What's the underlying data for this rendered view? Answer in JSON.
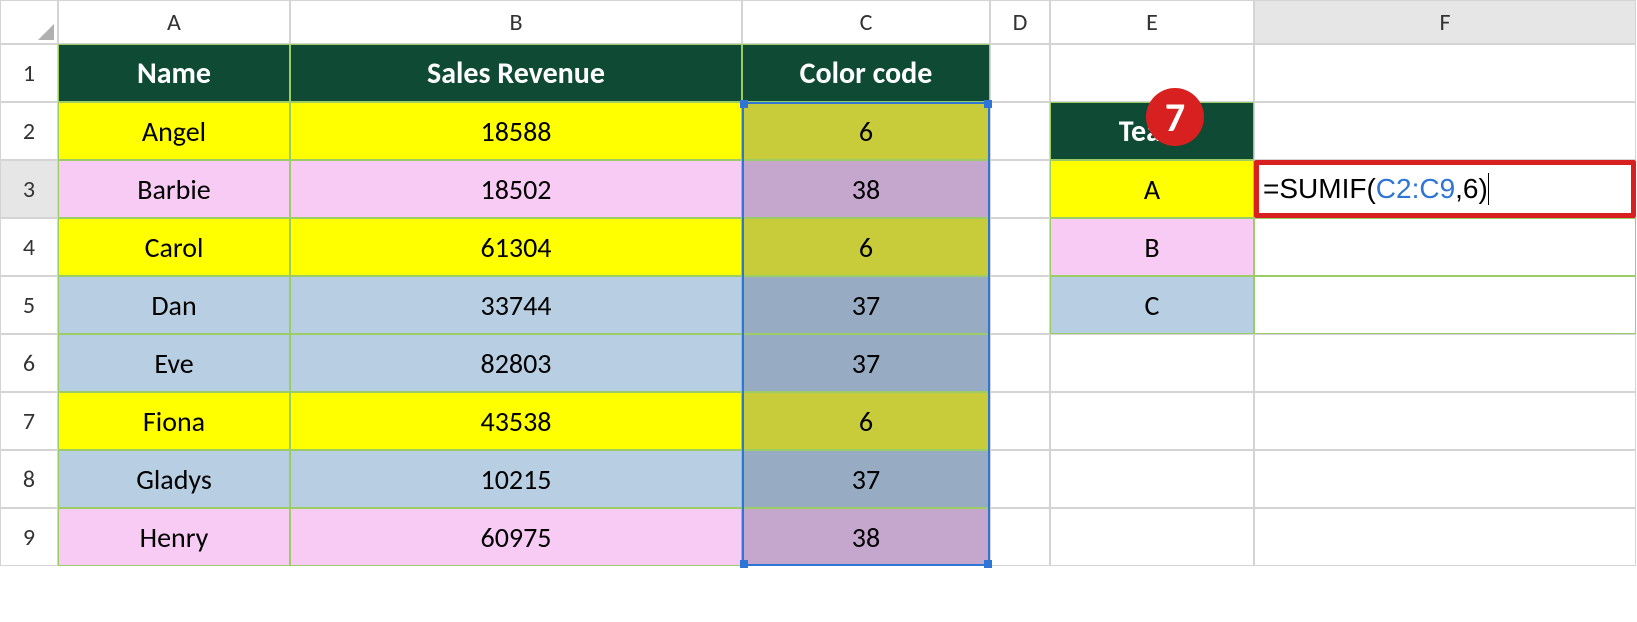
{
  "columns": [
    "A",
    "B",
    "C",
    "D",
    "E",
    "F"
  ],
  "rows": [
    "1",
    "2",
    "3",
    "4",
    "5",
    "6",
    "7",
    "8",
    "9"
  ],
  "headers": {
    "name": "Name",
    "sales": "Sales Revenue",
    "color_code": "Color code",
    "team": "Team"
  },
  "data_rows": [
    {
      "name": "Angel",
      "sales": "18588",
      "code": "6",
      "cls": "yellow"
    },
    {
      "name": "Barbie",
      "sales": "18502",
      "code": "38",
      "cls": "pink"
    },
    {
      "name": "Carol",
      "sales": "61304",
      "code": "6",
      "cls": "yellow"
    },
    {
      "name": "Dan",
      "sales": "33744",
      "code": "37",
      "cls": "blue"
    },
    {
      "name": "Eve",
      "sales": "82803",
      "code": "37",
      "cls": "blue"
    },
    {
      "name": "Fiona",
      "sales": "43538",
      "code": "6",
      "cls": "yellow"
    },
    {
      "name": "Gladys",
      "sales": "10215",
      "code": "37",
      "cls": "blue"
    },
    {
      "name": "Henry",
      "sales": "60975",
      "code": "38",
      "cls": "pink"
    }
  ],
  "team_rows": [
    {
      "label": "A",
      "cls": "bg-yellow"
    },
    {
      "label": "B",
      "cls": "bg-pink"
    },
    {
      "label": "C",
      "cls": "bg-blue"
    }
  ],
  "formula": {
    "prefix": "=SUMIF(",
    "ref": "C2:C9",
    "suffix": ",6)"
  },
  "callout_number": "7"
}
